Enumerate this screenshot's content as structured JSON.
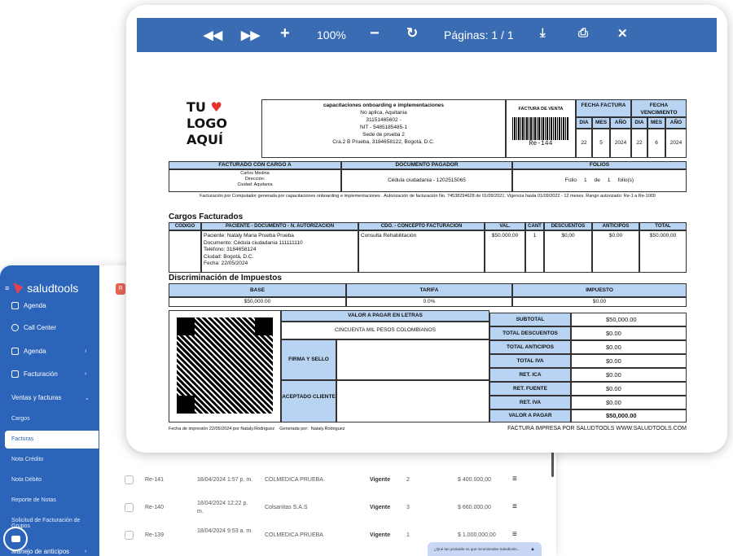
{
  "viewer": {
    "zoom": "100%",
    "pages": "Páginas: 1 / 1"
  },
  "invoice": {
    "logo_lines": [
      "TU",
      "LOGO",
      "AQUÍ"
    ],
    "company": [
      "capacitaciones onboarding e implementaciones",
      "No aplica, Aquitania",
      "3115146560​2 -",
      "NIT - 5485185485-1",
      "Sede de prueba 2",
      "Cra.2 B Prueba, 3184658122, Bogotá, D.C."
    ],
    "doc_type": "FACTURA DE VENTA",
    "barcode_text": "Re-144",
    "fecha_factura_label": "FECHA FACTURA",
    "fecha_vencimiento_label": "FECHA VENCIMIENTO",
    "dia": "DIA",
    "mes": "MES",
    "anio": "AÑO",
    "fecha_factura": [
      "22",
      "5",
      "2024"
    ],
    "fecha_vencimiento": [
      "22",
      "6",
      "2024"
    ],
    "facturado_label": "FACTURADO CON CARGO A",
    "facturado": [
      "Carlos Medina",
      "Dirección:",
      "Ciudad: Aquitania"
    ],
    "doc_pagador_label": "DOCUMENTO PAGADOR",
    "doc_pagador": "Cédula ciudadania - 1202515065",
    "folios_label": "FOLIOS",
    "folios": "Folio     1     de     1     folio(s)",
    "resolution": "Facturación  por Computador generada por capacitaciones onboarding e implementaciones .  Autorización de facturación No. 74538294628 de 01/09/2021. Vigencia hasta 01/09/2022 - 12 meses. Rango autorizado:  Re-1 a Re-1000",
    "cargos_title": "Cargos Facturados",
    "cargos_headers": [
      "CÓDIGO",
      "PACIENTE - DOCUMENTO - N. AUTORIZACIÓN",
      "CDO. - CONCEPTO FACTURACIÓN",
      "VAL.",
      "CANT",
      "DESCUENTOS",
      "ANTICIPOS",
      "TOTAL"
    ],
    "cargos_paciente": [
      "Paciente: Nataly Maria Prueba Prueba",
      "Documento: Cédula ciudadania 111111110",
      "Teléfono: 3184658124",
      "Ciudad: Bogotá, D.C.",
      "Fecha: 22/05/2024"
    ],
    "cargos_row": {
      "concepto": "Consulta Rehabilitación",
      "val": "$50.000,00",
      "cant": "1",
      "desc": "$0,00",
      "antic": "$0,00",
      "total": "$50.000,00"
    },
    "impuestos_title": "Discriminación de Impuestos",
    "impuestos_headers": [
      "BASE",
      "TARIFA",
      "IMPUESTO"
    ],
    "impuestos_row": [
      "$50,000.00",
      "0.0%",
      "$0.00"
    ],
    "valor_letras_label": "VALOR A PAGAR EN LETRAS",
    "valor_letras": "CINCUENTA MIL PESOS COLOMBIANOS",
    "firma_label": "FIRMA Y SELLO",
    "aceptado_label": "ACEPTADO CLIENTE",
    "totals": [
      {
        "label": "SUBTOTAL",
        "value": "$50,000.00"
      },
      {
        "label": "TOTAL DESCUENTOS",
        "value": "$0.00"
      },
      {
        "label": "TOTAL ANTICIPOS",
        "value": "$0.00"
      },
      {
        "label": "TOTAL IVA",
        "value": "$0.00"
      },
      {
        "label": "RET. ICA",
        "value": "$0.00"
      },
      {
        "label": "RET. FUENTE",
        "value": "$0.00"
      },
      {
        "label": "RET. IVA",
        "value": "$0.00"
      },
      {
        "label": "VALOR A PAGAR",
        "value": "$50,000.00"
      }
    ],
    "footer_left": "Fecha de impresión 22/05/2024 por Nataly.Rodriguez    Generada por:  Nataly.Rodriguez",
    "footer_right": "FACTURA IMPRESA POR SALUDTOOLS WWW.SALUDTOOLS.COM"
  },
  "app": {
    "brand": "saludtools",
    "tab_badge": "R",
    "menu": {
      "agenda_top": "Agenda",
      "call_center": "Call Center",
      "agenda": "Agenda",
      "facturacion": "Facturación",
      "ventas": "Ventas y facturas",
      "cargos": "Cargos",
      "facturas": "Facturas",
      "nota_credito": "Nota Crédito",
      "nota_debito": "Nota Débito",
      "reporte_notas": "Reporte de Notas",
      "solicitud": "Solicitud de Facturación de",
      "solicitud2": "Grupos",
      "anticipos": "Manejo de anticipos"
    },
    "rows": [
      {
        "id": "Re-141",
        "date": "18/04/2024 1:57 p. m.",
        "client": "COLMEDICA PRUEBA",
        "status": "Vigente",
        "n": "2",
        "amount": "$ 400.000,00"
      },
      {
        "id": "Re-140",
        "date": "18/04/2024 12:22 p. m.",
        "client": "Colsanitas S.A.S",
        "status": "Vigente",
        "n": "3",
        "amount": "$ 660.000,00"
      },
      {
        "id": "Re-139",
        "date": "18/04/2024 9:53 a. m.",
        "client": "COLMEDICA PRUEBA",
        "status": "Vigente",
        "n": "1",
        "amount": "$ 1.000.000,00"
      }
    ],
    "survey": "¿Qué tan probable es que recomiendes Saludtools..."
  }
}
